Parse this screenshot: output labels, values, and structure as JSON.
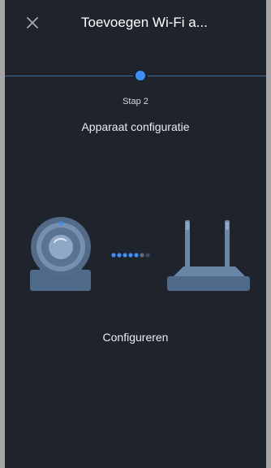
{
  "header": {
    "title": "Toevoegen Wi-Fi a..."
  },
  "stepper": {
    "step_label": "Stap 2",
    "step_title": "Apparaat configuratie"
  },
  "status": {
    "text": "Configureren"
  },
  "icons": {
    "close": "close-icon",
    "camera": "webcam-icon",
    "router": "router-icon",
    "progress": "connection-dots"
  },
  "colors": {
    "background": "#1f242c",
    "accent": "#3d8ff7",
    "device": "#5b7595"
  }
}
